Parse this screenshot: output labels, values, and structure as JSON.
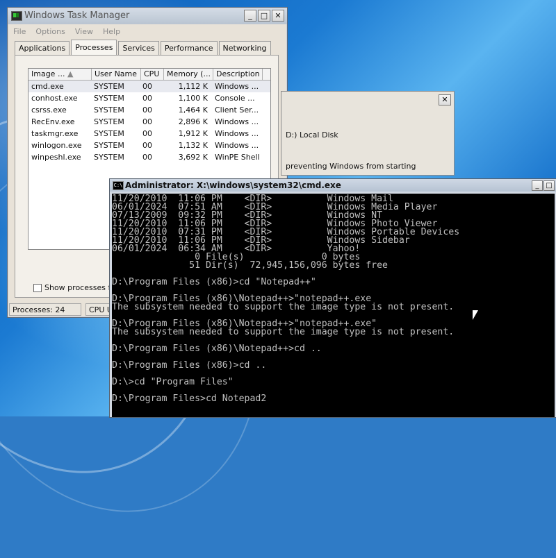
{
  "colors": {
    "desktop": "#1b7ad2",
    "console_bg": "#000000",
    "console_fg": "#c0c0c0"
  },
  "task_manager": {
    "title": "Windows Task Manager",
    "menu": [
      "File",
      "Options",
      "View",
      "Help"
    ],
    "tabs": [
      "Applications",
      "Processes",
      "Services",
      "Performance",
      "Networking"
    ],
    "active_tab": "Processes",
    "columns": [
      "Image ...",
      "User Name",
      "CPU",
      "Memory (...",
      "Description"
    ],
    "rows": [
      {
        "image": "cmd.exe",
        "user": "SYSTEM",
        "cpu": "00",
        "mem": "1,112 K",
        "desc": "Windows ..."
      },
      {
        "image": "conhost.exe",
        "user": "SYSTEM",
        "cpu": "00",
        "mem": "1,100 K",
        "desc": "Console ..."
      },
      {
        "image": "csrss.exe",
        "user": "SYSTEM",
        "cpu": "00",
        "mem": "1,464 K",
        "desc": "Client Ser..."
      },
      {
        "image": "RecEnv.exe",
        "user": "SYSTEM",
        "cpu": "00",
        "mem": "2,896 K",
        "desc": "Windows ..."
      },
      {
        "image": "taskmgr.exe",
        "user": "SYSTEM",
        "cpu": "00",
        "mem": "1,912 K",
        "desc": "Windows ..."
      },
      {
        "image": "winlogon.exe",
        "user": "SYSTEM",
        "cpu": "00",
        "mem": "1,132 K",
        "desc": "Windows ..."
      },
      {
        "image": "winpeshl.exe",
        "user": "SYSTEM",
        "cpu": "00",
        "mem": "3,692 K",
        "desc": "WinPE Shell"
      }
    ],
    "show_all_label": "Show processes from",
    "status_processes": "Processes: 24",
    "status_cpu": "CPU U"
  },
  "dialog": {
    "line1": "D:) Local Disk",
    "line2": "preventing Windows from starting"
  },
  "cmd": {
    "title": "Administrator: X:\\windows\\system32\\cmd.exe",
    "icon_text": "C:\\",
    "lines": [
      "11/20/2010  11:06 PM    <DIR>          Windows Mail",
      "06/01/2024  07:51 AM    <DIR>          Windows Media Player",
      "07/13/2009  09:32 PM    <DIR>          Windows NT",
      "11/20/2010  11:06 PM    <DIR>          Windows Photo Viewer",
      "11/20/2010  07:31 PM    <DIR>          Windows Portable Devices",
      "11/20/2010  11:06 PM    <DIR>          Windows Sidebar",
      "06/01/2024  06:34 AM    <DIR>          Yahoo!",
      "               0 File(s)              0 bytes",
      "              51 Dir(s)  72,945,156,096 bytes free",
      "",
      "D:\\Program Files (x86)>cd \"Notepad++\"",
      "",
      "D:\\Program Files (x86)\\Notepad++>\"notepad++.exe",
      "The subsystem needed to support the image type is not present.",
      "",
      "D:\\Program Files (x86)\\Notepad++>\"notepad++.exe\"",
      "The subsystem needed to support the image type is not present.",
      "",
      "D:\\Program Files (x86)\\Notepad++>cd ..",
      "",
      "D:\\Program Files (x86)>cd ..",
      "",
      "D:\\>cd \"Program Files\"",
      "",
      "D:\\Program Files>cd Notepad2"
    ]
  }
}
